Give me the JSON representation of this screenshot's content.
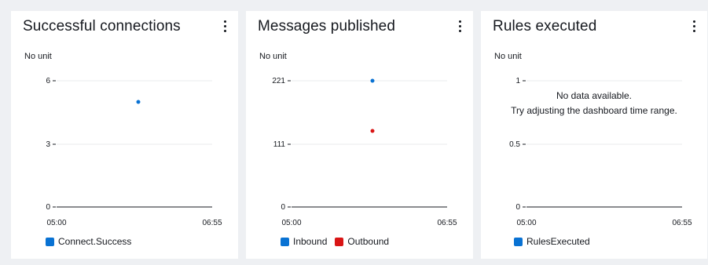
{
  "colors": {
    "blue": "#0972d3",
    "red": "#d91515",
    "grid": "#e9ebed",
    "axis": "#16191f"
  },
  "widgets": [
    {
      "title": "Successful connections",
      "unit": "No unit",
      "menu_icon": "vertical-ellipsis-icon",
      "y_ticks": [
        "6",
        "3",
        "0"
      ],
      "x_ticks": [
        "05:00",
        "06:55"
      ],
      "legend": [
        {
          "label": "Connect.Success",
          "color": "#0972d3"
        }
      ]
    },
    {
      "title": "Messages published",
      "unit": "No unit",
      "menu_icon": "vertical-ellipsis-icon",
      "y_ticks": [
        "221",
        "111",
        "0"
      ],
      "x_ticks": [
        "05:00",
        "06:55"
      ],
      "legend": [
        {
          "label": "Inbound",
          "color": "#0972d3"
        },
        {
          "label": "Outbound",
          "color": "#d91515"
        }
      ]
    },
    {
      "title": "Rules executed",
      "unit": "No unit",
      "menu_icon": "vertical-ellipsis-icon",
      "y_ticks": [
        "1",
        "0.5",
        "0"
      ],
      "x_ticks": [
        "05:00",
        "06:55"
      ],
      "no_data_line1": "No data available.",
      "no_data_line2": "Try adjusting the dashboard time range.",
      "legend": [
        {
          "label": "RulesExecuted",
          "color": "#0972d3"
        }
      ]
    }
  ],
  "chart_data": [
    {
      "type": "scatter",
      "title": "Successful connections",
      "ylabel": "No unit",
      "x_range": [
        "05:00",
        "06:55"
      ],
      "ylim": [
        0,
        6
      ],
      "series": [
        {
          "name": "Connect.Success",
          "points": [
            {
              "x": "06:00",
              "y": 5
            }
          ]
        }
      ]
    },
    {
      "type": "scatter",
      "title": "Messages published",
      "ylabel": "No unit",
      "x_range": [
        "05:00",
        "06:55"
      ],
      "ylim": [
        0,
        221
      ],
      "series": [
        {
          "name": "Inbound",
          "points": [
            {
              "x": "06:00",
              "y": 221
            }
          ]
        },
        {
          "name": "Outbound",
          "points": [
            {
              "x": "06:00",
              "y": 142
            }
          ]
        }
      ]
    },
    {
      "type": "line",
      "title": "Rules executed",
      "ylabel": "No unit",
      "x_range": [
        "05:00",
        "06:55"
      ],
      "ylim": [
        0,
        1
      ],
      "series": [
        {
          "name": "RulesExecuted",
          "points": []
        }
      ]
    }
  ]
}
